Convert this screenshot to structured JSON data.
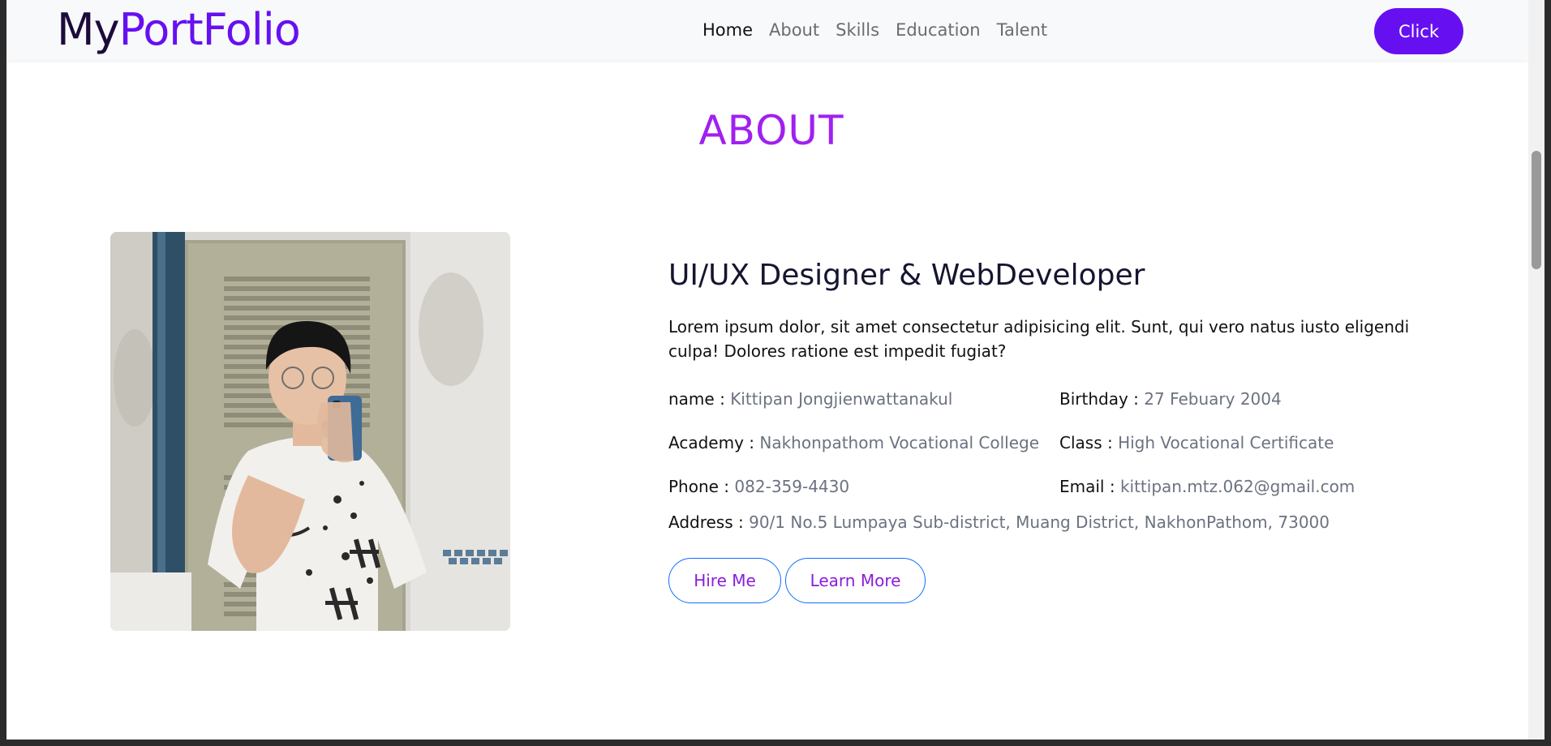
{
  "navbar": {
    "brand_my": "My",
    "brand_portfolio": "PortFolio",
    "links": [
      "Home",
      "About",
      "Skills",
      "Education",
      "Talent"
    ],
    "active_link": "Home",
    "cta_label": "Click"
  },
  "about": {
    "section_title": "ABOUT",
    "role_title": "UI/UX Designer & WebDeveloper",
    "description": "Lorem ipsum dolor, sit amet consectetur adipisicing elit. Sunt, qui vero natus iusto eligendi culpa! Dolores ratione est impedit fugiat?",
    "fields": {
      "name": {
        "label": "name :",
        "value": "Kittipan Jongjienwattanakul"
      },
      "birthday": {
        "label": "Birthday :",
        "value": "27 Febuary 2004"
      },
      "academy": {
        "label": "Academy :",
        "value": "Nakhonpathom Vocational College"
      },
      "class": {
        "label": "Class :",
        "value": "High Vocational Certificate"
      },
      "phone": {
        "label": "Phone :",
        "value": "082-359-4430"
      },
      "email": {
        "label": "Email :",
        "value": "kittipan.mtz.062@gmail.com"
      },
      "address": {
        "label": "Address :",
        "value": "90/1 No.5 Lumpaya Sub-district, Muang District, NakhonPathom, 73000"
      }
    },
    "buttons": {
      "hire": "Hire Me",
      "learn": "Learn More"
    }
  },
  "colors": {
    "brand_purple": "#6610f2",
    "title_purple": "#a020f0",
    "outline_blue": "#0d6efd",
    "muted_text": "#6b7280"
  }
}
